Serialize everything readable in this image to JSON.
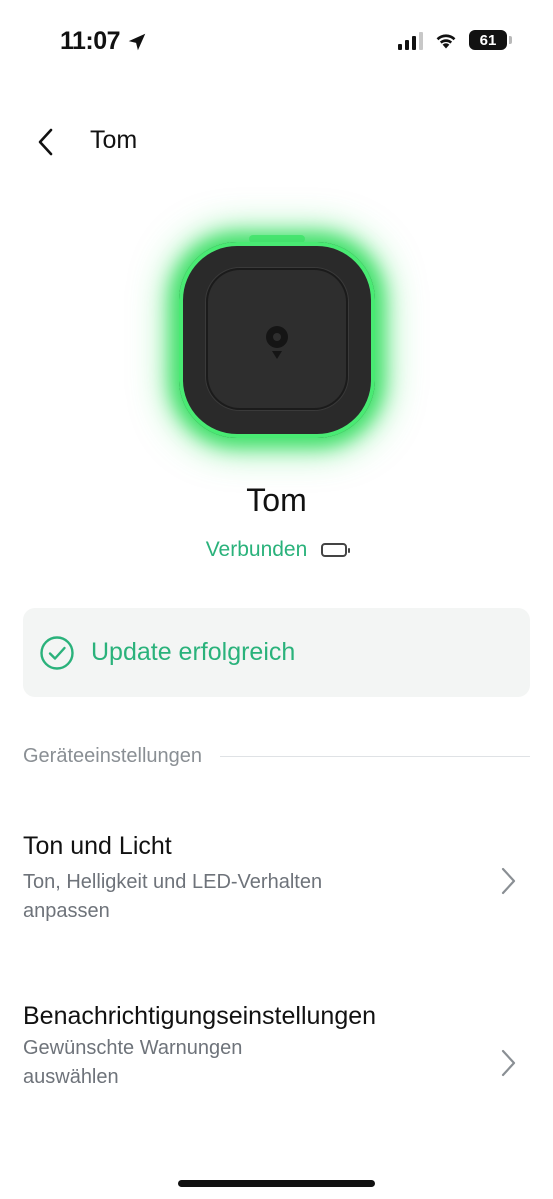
{
  "status_bar": {
    "time": "11:07",
    "battery_level": "61",
    "icons": [
      "location-arrow-icon",
      "cellular-signal-icon",
      "wifi-icon",
      "battery-icon"
    ]
  },
  "nav": {
    "title": "Tom",
    "back_icon": "chevron-left-icon"
  },
  "device": {
    "name": "Tom",
    "connection_status": "Verbunden",
    "glow_color": "#41e06a"
  },
  "update_banner": {
    "text": "Update erfolgreich",
    "icon": "check-circle-icon"
  },
  "section": {
    "label": "Geräteeinstellungen"
  },
  "settings": [
    {
      "title": "Ton und Licht",
      "description": "Ton, Helligkeit und LED-Verhalten anpassen"
    },
    {
      "title": "Benachrichtigungseinstellungen",
      "description": "Gewünschte Warnungen auswählen"
    }
  ],
  "colors": {
    "accent": "#2ab27b",
    "card_bg": "#f3f5f4"
  }
}
